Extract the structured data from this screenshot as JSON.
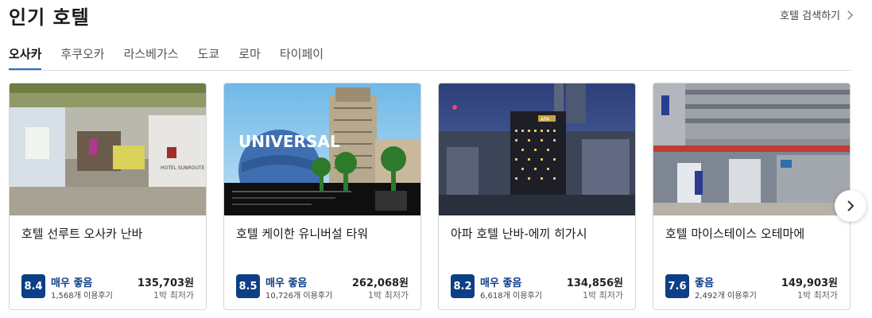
{
  "header": {
    "title": "인기 호텔",
    "search_link": "호텔 검색하기"
  },
  "tabs": [
    {
      "label": "오사카",
      "active": true
    },
    {
      "label": "후쿠오카",
      "active": false
    },
    {
      "label": "라스베가스",
      "active": false
    },
    {
      "label": "도쿄",
      "active": false
    },
    {
      "label": "로마",
      "active": false
    },
    {
      "label": "타이페이",
      "active": false
    }
  ],
  "colors": {
    "accent_tab": "#1e70c8",
    "score_badge": "#0d3f86"
  },
  "hotels": [
    {
      "name": "호텔 선루트 오사카 난바",
      "score": "8.4",
      "rating_word": "매우 좋음",
      "reviews": "1,568개 이용후기",
      "price": "135,703원",
      "per_night": "1박 최저가",
      "photo_sign": "HOTEL SUNROUTE"
    },
    {
      "name": "호텔 케이한 유니버설 타워",
      "score": "8.5",
      "rating_word": "매우 좋음",
      "reviews": "10,726개 이용후기",
      "price": "262,068원",
      "per_night": "1박 최저가",
      "photo_sign": "UNIVERSAL"
    },
    {
      "name": "아파 호텔 난바-에끼 히가시",
      "score": "8.2",
      "rating_word": "매우 좋음",
      "reviews": "6,618개 이용후기",
      "price": "134,856원",
      "per_night": "1박 최저가",
      "photo_sign": "APA"
    },
    {
      "name": "호텔 마이스테이스 오테마에",
      "score": "7.6",
      "rating_word": "좋음",
      "reviews": "2,492개 이용후기",
      "price": "149,903원",
      "per_night": "1박 최저가",
      "photo_sign": ""
    }
  ],
  "icons": {
    "next": "chevron-right-icon",
    "search_chevron": "chevron-right-icon"
  }
}
